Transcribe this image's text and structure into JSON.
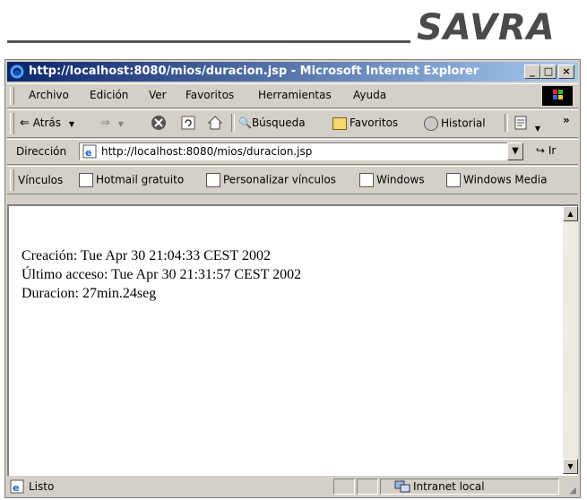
{
  "logo": {
    "text": "SAVRA"
  },
  "window": {
    "title": "http://localhost:8080/mios/duracion.jsp - Microsoft Internet Explorer",
    "controls": [
      "_",
      "□",
      "×"
    ]
  },
  "menu": {
    "items": [
      "Archivo",
      "Edición",
      "Ver",
      "Favoritos",
      "Herramientas",
      "Ayuda"
    ]
  },
  "toolbar": {
    "back_label": "Atrás",
    "search_label": "Búsqueda",
    "favorites_label": "Favoritos",
    "history_label": "Historial",
    "more_label": "»"
  },
  "address": {
    "label": "Dirección",
    "url": "http://localhost:8080/mios/duracion.jsp",
    "go_label": "Ir"
  },
  "links": {
    "label": "Vínculos",
    "items": [
      "Hotmail gratuito",
      "Personalizar vínculos",
      "Windows",
      "Windows Media"
    ]
  },
  "page": {
    "lines": [
      "Creación: Tue Apr 30 21:04:33 CEST 2002",
      "Último acceso: Tue Apr 30 21:31:57 CEST 2002",
      "Duracion: 27min.24seg"
    ]
  },
  "status": {
    "text": "Listo",
    "zone": "Intranet local"
  },
  "colors": {
    "titlebar_start": "#0a246a",
    "titlebar_end": "#a6caf0",
    "chrome": "#d4d0c8"
  }
}
